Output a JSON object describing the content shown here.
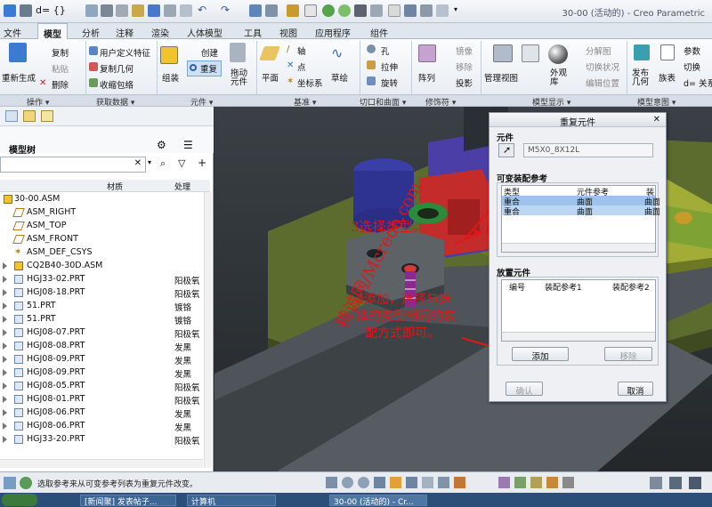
{
  "window": {
    "title": "30-00 (活动的) - Creo Parametric"
  },
  "ribbon_tabs": [
    "文件",
    "模型",
    "分析",
    "注释",
    "渲染",
    "人体模型",
    "工具",
    "视图",
    "应用程序",
    "组件"
  ],
  "ribbon": {
    "regenerate": "重新生成",
    "copy": "复制",
    "paste": "粘贴",
    "delete": "删除",
    "user_feature": "用户定义特征",
    "copy_geom": "复制几何",
    "shrinkwrap": "收缩包络",
    "assemble": "组装",
    "create": "创建",
    "repeat": "重复",
    "drag": "拖动\n元件",
    "plane": "平面",
    "axis": "轴",
    "point": "点",
    "csys": "坐标系",
    "sketch": "草绘",
    "hole": "孔",
    "extrude": "拉伸",
    "revolve": "旋转",
    "pattern": "阵列",
    "mirror": "镜像",
    "remove": "移除",
    "project": "投影",
    "manage_views": "管理视图",
    "appearance": "外观\n库",
    "explode": "分解图",
    "toggle_status": "切换状况",
    "edit_position": "编辑位置",
    "publish_geom": "发布\n几何",
    "table": "族表",
    "param": "参数",
    "switch": "切换",
    "relation": "d= 关系"
  },
  "ribbon_groups": [
    "操作 ▾",
    "获取数据 ▾",
    "元件 ▾",
    "基准 ▾",
    "切口和曲面 ▾",
    "修饰符 ▾",
    "模型显示 ▾",
    "模型意图 ▾"
  ],
  "model_tree": {
    "title": "模型树",
    "col_material": "材质",
    "col_process": "处理",
    "rows": [
      {
        "name": "30-00.ASM",
        "process": ""
      },
      {
        "name": "ASM_RIGHT",
        "process": ""
      },
      {
        "name": "ASM_TOP",
        "process": ""
      },
      {
        "name": "ASM_FRONT",
        "process": ""
      },
      {
        "name": "ASM_DEF_CSYS",
        "process": ""
      },
      {
        "name": "CQ2B40-30D.ASM",
        "process": ""
      },
      {
        "name": "HGJ33-02.PRT",
        "process": "阳极氧"
      },
      {
        "name": "HGJ08-18.PRT",
        "process": "阳极氧"
      },
      {
        "name": "51.PRT",
        "process": "镀铬"
      },
      {
        "name": "51.PRT",
        "process": "镀铬"
      },
      {
        "name": "HGJ08-07.PRT",
        "process": "阳极氧"
      },
      {
        "name": "HGJ08-08.PRT",
        "process": "发黑"
      },
      {
        "name": "HGJ08-09.PRT",
        "process": "发黑"
      },
      {
        "name": "HGJ08-09.PRT",
        "process": "发黑"
      },
      {
        "name": "HGJ08-05.PRT",
        "process": "阳极氧"
      },
      {
        "name": "HGJ08-01.PRT",
        "process": "阳极氧"
      },
      {
        "name": "HGJ08-06.PRT",
        "process": "发黑"
      },
      {
        "name": "HGJ08-06.PRT",
        "process": "发黑"
      },
      {
        "name": "HGJ33-20.PRT",
        "process": "阳极氧"
      }
    ]
  },
  "dialog": {
    "title": "重复元件",
    "component_label": "元件",
    "component_value": "M5X0_8X12L",
    "variable_refs_label": "可变装配参考",
    "col_type": "类型",
    "col_comp_ref": "元件参考",
    "col_asm": "装",
    "refs": [
      {
        "type": "重合",
        "comp_ref": "曲面",
        "asm": "曲面"
      },
      {
        "type": "重合",
        "comp_ref": "曲面",
        "asm": "曲面"
      }
    ],
    "place_label": "放置元件",
    "col_no": "编号",
    "col_asm_ref1": "装配参考1",
    "col_asm_ref2": "装配参考2",
    "add_button": "添加",
    "remove_button": "移除",
    "confirm_button": "确认",
    "cancel_button": "取消"
  },
  "annotations": {
    "step3": "3选择类型。",
    "step4_line1": "4添加，选择与选",
    "step4_line2": "择的类型相同的装",
    "step4_line3": "配方式即可。",
    "watermark": "精诚网/Mcreoo.com"
  },
  "status": {
    "message": "选取参考来从可变参考列表为重复元件改变。"
  },
  "taskbar": {
    "item1": "[新闻聚] 发表帖子...",
    "item2": "计算机",
    "item3": "30-00 (活动的) - Cr..."
  }
}
